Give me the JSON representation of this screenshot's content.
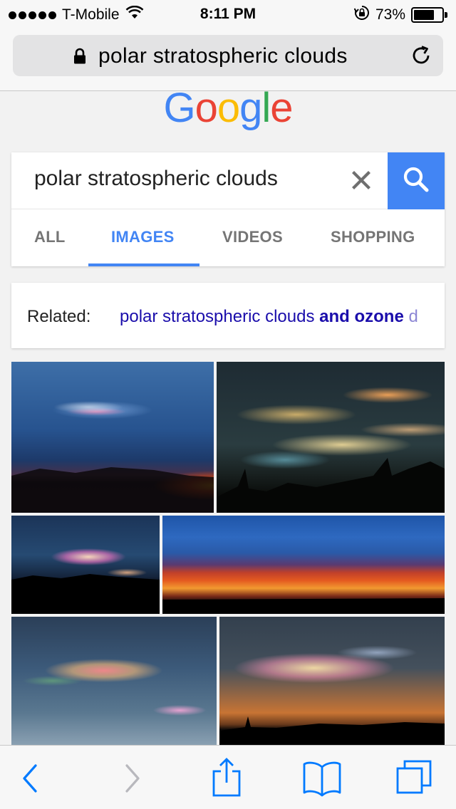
{
  "status_bar": {
    "carrier": "T-Mobile",
    "time": "8:11 PM",
    "battery_percent": "73%",
    "battery_level": 0.73,
    "signal_dots": 5,
    "icons": [
      "signal-dots-icon",
      "wifi-icon",
      "rotation-lock-icon",
      "battery-icon"
    ]
  },
  "url_bar": {
    "text": "polar stratospheric clouds",
    "icons": [
      "lock-icon",
      "reload-icon"
    ]
  },
  "logo": {
    "letters": [
      "G",
      "o",
      "o",
      "g",
      "l",
      "e"
    ],
    "colors": [
      "#4285f4",
      "#ea4335",
      "#fbbc05",
      "#4285f4",
      "#34a853",
      "#ea4335"
    ]
  },
  "search": {
    "query": "polar stratospheric clouds",
    "accent_color": "#4285f4",
    "icons": [
      "clear-icon",
      "search-icon"
    ]
  },
  "tabs": [
    {
      "label": "ALL",
      "active": false
    },
    {
      "label": "IMAGES",
      "active": true
    },
    {
      "label": "VIDEOS",
      "active": false
    },
    {
      "label": "SHOPPING",
      "active": false
    }
  ],
  "related": {
    "label": "Related:",
    "link_prefix": "polar stratospheric clouds ",
    "link_bold": "and ozone",
    "link_suffix": " d",
    "link_color": "#1a0dab"
  },
  "images": [
    {
      "name": "image-result-1"
    },
    {
      "name": "image-result-2"
    },
    {
      "name": "image-result-3"
    },
    {
      "name": "image-result-4"
    },
    {
      "name": "image-result-5"
    },
    {
      "name": "image-result-6"
    }
  ],
  "toolbar": {
    "icons": [
      "back-icon",
      "forward-icon",
      "share-icon",
      "bookmarks-icon",
      "tabs-icon"
    ],
    "tint_color": "#007aff",
    "disabled_color": "#b8b8bd"
  }
}
